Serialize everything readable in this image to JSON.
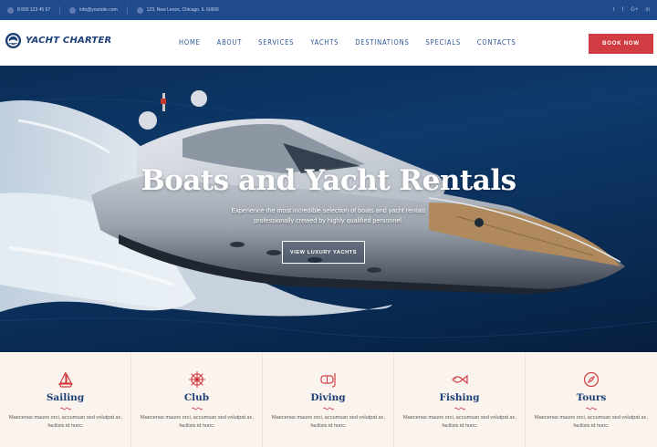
{
  "topbar": {
    "phone": "8 800 123 45 67",
    "email": "info@yoursite.com",
    "address": "123, New Lenox, Chicago, IL 60606",
    "social": [
      "Twitter",
      "Facebook",
      "Google+",
      "LinkedIn"
    ],
    "social_glyphs": [
      "t",
      "f",
      "G+",
      "in"
    ]
  },
  "brand": {
    "name": "YACHT CHARTER"
  },
  "nav": {
    "items": [
      "HOME",
      "ABOUT",
      "SERVICES",
      "YACHTS",
      "DESTINATIONS",
      "SPECIALS",
      "CONTACTS"
    ],
    "book_label": "BOOK NOW"
  },
  "hero": {
    "title": "Boats and Yacht Rentals",
    "subtitle": "Experience the most incredible selection of boats and yacht rentals professionally crewed by highly qualified personnel.",
    "button_label": "VIEW LUXURY YACHTS"
  },
  "features": [
    {
      "title": "Sailing",
      "text": "Maecenas mauris orci, accumsan sed volutpat ac, facilisis id nunc.",
      "icon": "sailboat-icon"
    },
    {
      "title": "Club",
      "text": "Maecenas mauris orci, accumsan sed volutpat ac, facilisis id nunc.",
      "icon": "ship-wheel-icon"
    },
    {
      "title": "Diving",
      "text": "Maecenas mauris orci, accumsan sed volutpat ac, facilisis id nunc.",
      "icon": "snorkel-mask-icon"
    },
    {
      "title": "Fishing",
      "text": "Maecenas mauris orci, accumsan sed volutpat ac, facilisis id nunc.",
      "icon": "fish-icon"
    },
    {
      "title": "Tours",
      "text": "Maecenas mauris orci, accumsan sed volutpat ac, facilisis id nunc.",
      "icon": "compass-icon"
    }
  ],
  "colors": {
    "topbar_bg": "#1f4a8c",
    "brand_blue": "#1d3f78",
    "nav_blue": "#2b5592",
    "accent_red": "#d13c43",
    "features_bg": "#fbf4ee"
  }
}
